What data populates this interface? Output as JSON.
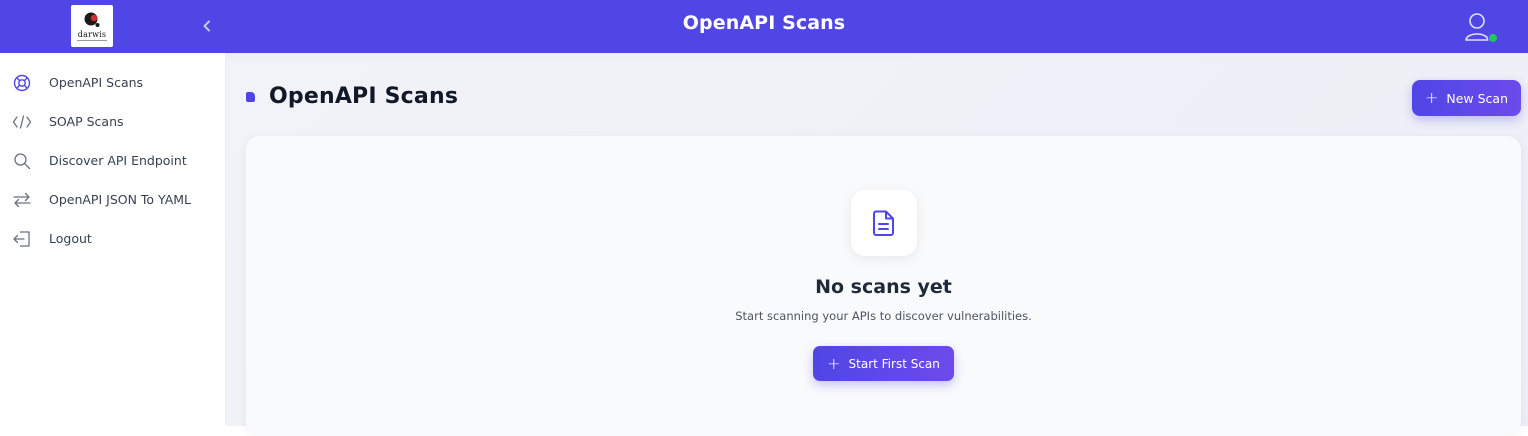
{
  "header": {
    "title": "OpenAPI Scans",
    "logo_text": "darwis",
    "collapse_icon": "chevron-left-icon",
    "user_icon": "user-icon",
    "user_status_color": "#22c55e",
    "brand_color": "#5046e5"
  },
  "sidebar": {
    "items": [
      {
        "label": "OpenAPI Scans",
        "icon": "lifebuoy-icon"
      },
      {
        "label": "SOAP Scans",
        "icon": "code-icon"
      },
      {
        "label": "Discover API Endpoint",
        "icon": "search-icon"
      },
      {
        "label": "OpenAPI JSON To YAML",
        "icon": "arrows-swap-icon"
      },
      {
        "label": "Logout",
        "icon": "logout-icon"
      }
    ]
  },
  "main": {
    "page_title": "OpenAPI Scans",
    "new_scan_label": "New Scan",
    "empty_state": {
      "icon": "document-icon",
      "title": "No scans yet",
      "subtitle": "Start scanning your APIs to discover vulnerabilities.",
      "button_label": "Start First Scan"
    }
  }
}
